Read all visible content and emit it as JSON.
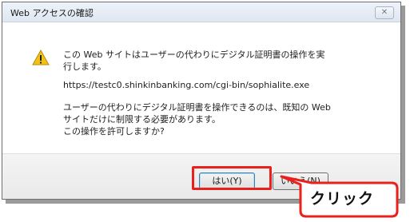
{
  "dialog": {
    "title": "Web アクセスの確認",
    "close_glyph": "✕",
    "message_line1": "この Web サイトはユーザーの代わりにデジタル証明書の操作を実行します。",
    "url": "https://testc0.shinkinbanking.com/cgi-bin/sophialite.exe",
    "message_line2": "ユーザーの代わりにデジタル証明書を操作できるのは、既知の Web サイトだけに制限する必要があります。",
    "message_line3": "この操作を許可しますか?",
    "yes_label": "はい(Y)",
    "no_label": "いいえ(N)",
    "icon": "warning-icon"
  },
  "annotation": {
    "callout_text": "クリック",
    "highlight_color": "#e8211d"
  }
}
